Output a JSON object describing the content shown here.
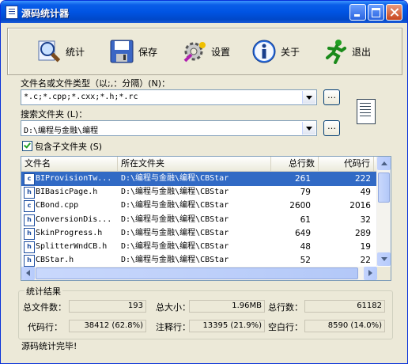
{
  "window": {
    "title": "源码统计器"
  },
  "toolbar": [
    {
      "label": "统计",
      "icon": "magnifier-icon"
    },
    {
      "label": "保存",
      "icon": "floppy-disk-icon"
    },
    {
      "label": "设置",
      "icon": "settings-gear-icon"
    },
    {
      "label": "关于",
      "icon": "info-icon"
    },
    {
      "label": "退出",
      "icon": "running-man-icon"
    }
  ],
  "file_types": {
    "label": "文件名或文件类型（以;,：分隔）(N)：",
    "value": "*.c;*.cpp;*.cxx;*.h;*.rc",
    "browse": "…"
  },
  "search_folder": {
    "label": "搜索文件夹 (L)：",
    "value": "D:\\编程与金融\\编程",
    "browse": "…"
  },
  "include_subfolders": {
    "label": "包含子文件夹 (S)",
    "checked": true
  },
  "list": {
    "columns": [
      "文件名",
      "所在文件夹",
      "总行数",
      "代码行"
    ],
    "rows": [
      {
        "icon": "c",
        "name": "BIProvisionTw...",
        "folder": "D:\\编程与金融\\编程\\CBStar",
        "total": "261",
        "code": "222",
        "selected": true
      },
      {
        "icon": "h",
        "name": "BIBasicPage.h",
        "folder": "D:\\编程与金融\\编程\\CBStar",
        "total": "79",
        "code": "49"
      },
      {
        "icon": "c",
        "name": "CBond.cpp",
        "folder": "D:\\编程与金融\\编程\\CBStar",
        "total": "2600",
        "code": "2016"
      },
      {
        "icon": "h",
        "name": "ConversionDis...",
        "folder": "D:\\编程与金融\\编程\\CBStar",
        "total": "61",
        "code": "32"
      },
      {
        "icon": "h",
        "name": "SkinProgress.h",
        "folder": "D:\\编程与金融\\编程\\CBStar",
        "total": "649",
        "code": "289"
      },
      {
        "icon": "h",
        "name": "SplitterWndCB.h",
        "folder": "D:\\编程与金融\\编程\\CBStar",
        "total": "48",
        "code": "19"
      },
      {
        "icon": "h",
        "name": "CBStar.h",
        "folder": "D:\\编程与金融\\编程\\CBStar",
        "total": "52",
        "code": "22"
      }
    ]
  },
  "stats": {
    "title": "统计结果",
    "total_files_label": "总文件数：",
    "total_files": "193",
    "total_size_label": "总大小：",
    "total_size": "1.96MB",
    "total_lines_label": "总行数：",
    "total_lines": "61182",
    "code_lines_label": "代码行：",
    "code_lines": "38412 (62.8%)",
    "comment_lines_label": "注释行：",
    "comment_lines": "13395 (21.9%)",
    "blank_lines_label": "空白行：",
    "blank_lines": "8590 (14.0%)"
  },
  "status": "源码统计完毕!"
}
